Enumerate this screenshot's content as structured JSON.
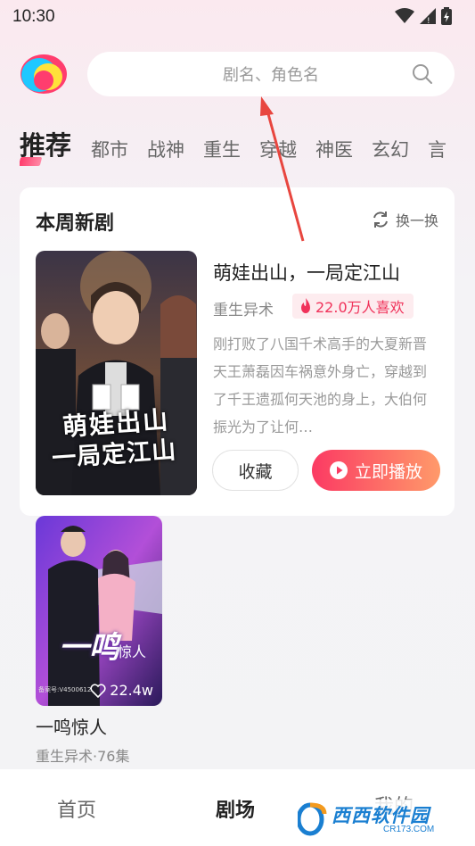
{
  "status_bar": {
    "time": "10:30"
  },
  "search": {
    "placeholder": "剧名、角色名"
  },
  "categories": [
    "推荐",
    "都市",
    "战神",
    "重生",
    "穿越",
    "神医",
    "玄幻",
    "言"
  ],
  "weekly": {
    "title": "本周新剧",
    "refresh_label": "换一换",
    "featured": {
      "title": "萌娃出山，一局定江山",
      "genre": "重生异术",
      "likes": "22.0万人喜欢",
      "description": "刚打败了八国千术高手的大夏新晋天王萧磊因车祸意外身亡，穿越到了千王遗孤何天池的身上，大伯何振光为了让何…",
      "poster_text_line1": "萌娃出山",
      "poster_text_line2": "一局定江山",
      "collect_label": "收藏",
      "play_label": "立即播放"
    }
  },
  "grid": [
    {
      "title": "一鸣惊人",
      "meta": "重生异术·76集",
      "favorites": "22.4w",
      "poster_text_big": "一鸣",
      "poster_text_small": "惊人",
      "poster_credit": "备案号:V4500612"
    }
  ],
  "nav": {
    "home": "首页",
    "theater": "剧场",
    "mine": "我的"
  },
  "watermark": {
    "line1": "西西软件园",
    "line2": "CR173.COM"
  },
  "colors": {
    "accent": "#fb3a63",
    "accent_end": "#ff9a6a",
    "likes": "#f0325a"
  }
}
